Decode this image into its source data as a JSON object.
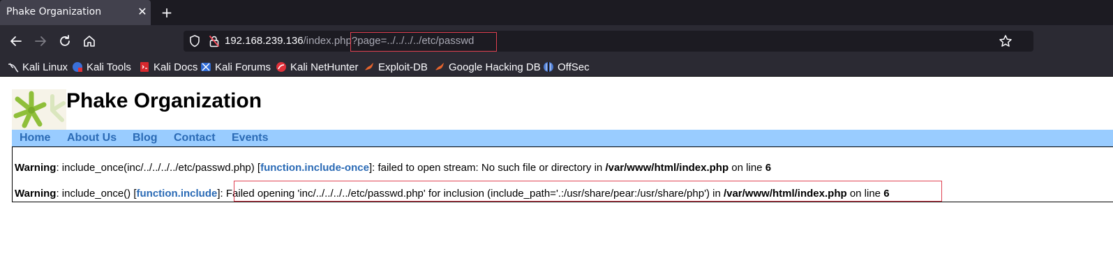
{
  "browser": {
    "tab_title": "Phake Organization",
    "tab_close": "✕",
    "new_tab": "+",
    "url_host": "192.168.239.136",
    "url_path": "/index.php",
    "url_query": "?page=../../../../etc/passwd",
    "bookmarks": [
      {
        "label": "Kali Linux",
        "icon": "kali-dragon-icon"
      },
      {
        "label": "Kali Tools",
        "icon": "kali-tools-icon"
      },
      {
        "label": "Kali Docs",
        "icon": "kali-docs-icon"
      },
      {
        "label": "Kali Forums",
        "icon": "kali-forums-icon"
      },
      {
        "label": "Kali NetHunter",
        "icon": "kali-nethunter-icon"
      },
      {
        "label": "Exploit-DB",
        "icon": "exploit-db-icon"
      },
      {
        "label": "Google Hacking DB",
        "icon": "ghdb-icon"
      },
      {
        "label": "OffSec",
        "icon": "offsec-icon"
      }
    ]
  },
  "site": {
    "title": "Phake Organization",
    "menu": [
      "Home",
      "About Us",
      "Blog",
      "Contact",
      "Events"
    ]
  },
  "warnings": [
    {
      "label": "Warning",
      "sep": ": ",
      "pre": "include_once(inc/../../../../etc/passwd.php) [",
      "fn": "function.include-once",
      "post": "]: failed to open stream: No such file or directory in ",
      "file": "/var/www/html/index.php",
      "online": " on line ",
      "line": "6"
    },
    {
      "label": "Warning",
      "sep": ": ",
      "pre": "include_once() [",
      "fn": "function.include",
      "post": "]: ",
      "highlighted": "Failed opening 'inc/../../../../etc/passwd.php' for inclusion (include_path='.:/usr/share/pear:/usr/share/php') in ",
      "file": "/var/www/html/index.php",
      "online": " on line ",
      "line": "6"
    }
  ],
  "colors": {
    "menu_bg": "#99ccff",
    "link": "#2a6ab5",
    "highlight_box": "#e04050"
  }
}
